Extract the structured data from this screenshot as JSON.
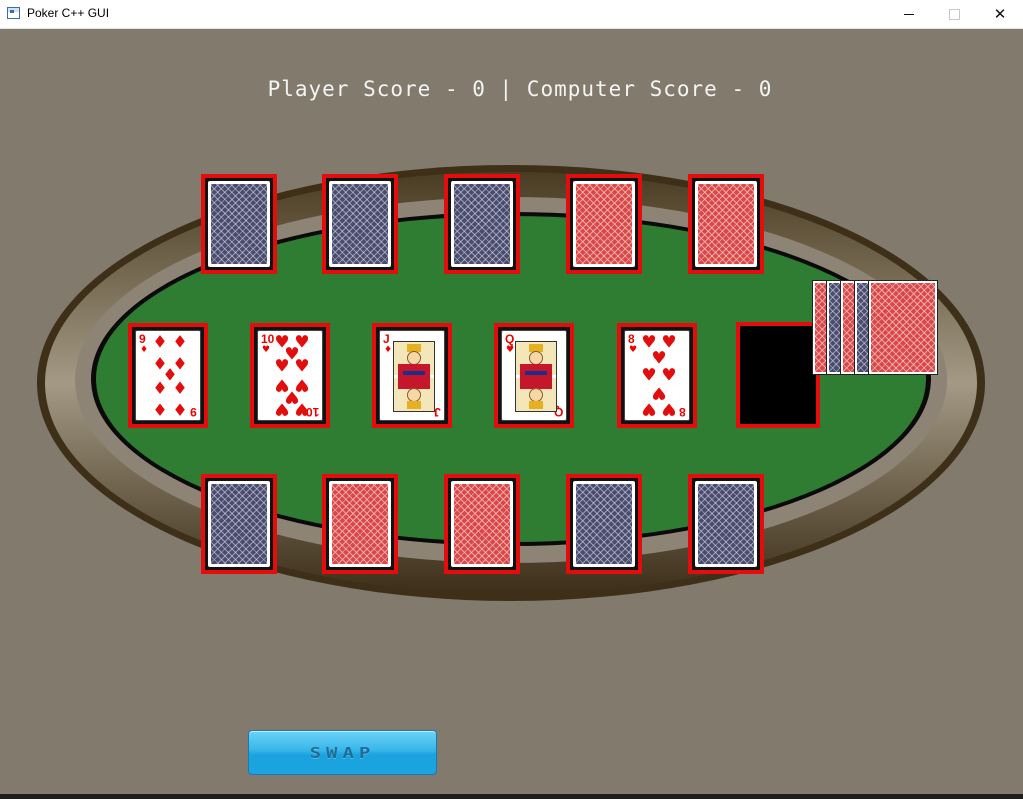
{
  "window": {
    "title": "Poker C++ GUI",
    "controls": {
      "minimize_icon": "minimize-icon",
      "maximize_icon": "maximize-icon",
      "close_icon": "close-icon",
      "close_glyph": "✕"
    }
  },
  "scoreboard": {
    "text": "Player Score - 0 | Computer Score - 0",
    "player_score": 0,
    "computer_score": 0
  },
  "table": {
    "felt_color": "#2e7d32",
    "rim_color": "#4a3c26",
    "background_color": "#827a6d"
  },
  "computer_hand": [
    {
      "face": "back",
      "back_color": "blue"
    },
    {
      "face": "back",
      "back_color": "blue"
    },
    {
      "face": "back",
      "back_color": "blue"
    },
    {
      "face": "back",
      "back_color": "red"
    },
    {
      "face": "back",
      "back_color": "red"
    }
  ],
  "community_cards": [
    {
      "rank": "9",
      "suit": "diamonds",
      "suit_glyph": "♦",
      "pips": 9
    },
    {
      "rank": "10",
      "suit": "hearts",
      "suit_glyph": "♥",
      "pips": 10
    },
    {
      "rank": "J",
      "suit": "diamonds",
      "suit_glyph": "♦",
      "court": "jack"
    },
    {
      "rank": "Q",
      "suit": "hearts",
      "suit_glyph": "♥",
      "court": "queen"
    },
    {
      "rank": "8",
      "suit": "hearts",
      "suit_glyph": "♥",
      "pips": 8
    },
    {
      "rank": "",
      "suit": "",
      "empty": true
    }
  ],
  "player_hand": [
    {
      "face": "back",
      "back_color": "blue"
    },
    {
      "face": "back",
      "back_color": "red"
    },
    {
      "face": "back",
      "back_color": "red"
    },
    {
      "face": "back",
      "back_color": "blue"
    },
    {
      "face": "back",
      "back_color": "blue"
    }
  ],
  "deck": {
    "visible_card_backs": [
      "red",
      "blue",
      "red",
      "blue",
      "red"
    ]
  },
  "actions": {
    "swap_label": "SWAP"
  },
  "colors": {
    "card_border": "#e50c0c",
    "button": "#29aee6",
    "score_text": "#f4f4f4"
  }
}
